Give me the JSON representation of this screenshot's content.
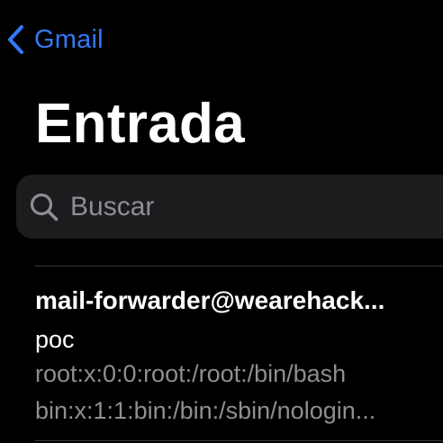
{
  "nav": {
    "back_label": "Gmail",
    "back_icon": "chevron-left-icon"
  },
  "page": {
    "title": "Entrada"
  },
  "search": {
    "placeholder": "Buscar",
    "value": "",
    "icon": "magnifier-icon"
  },
  "colors": {
    "accent": "#3478f6",
    "background": "#000000",
    "search_bg": "#1c1c1e",
    "secondary_text": "#8e8e93",
    "divider": "#38383a"
  },
  "messages": [
    {
      "sender": "mail-forwarder@wearehack...",
      "subject": "poc",
      "preview_lines": [
        "root:x:0:0:root:/root:/bin/bash",
        "bin:x:1:1:bin:/bin:/sbin/nologin..."
      ]
    }
  ]
}
